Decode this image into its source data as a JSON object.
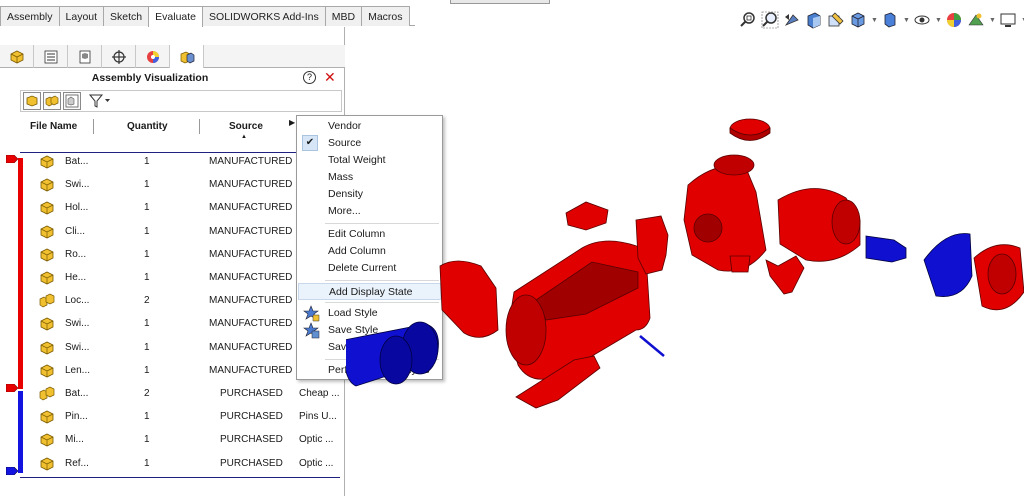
{
  "tabs": [
    {
      "label": "Assembly",
      "active": false
    },
    {
      "label": "Layout",
      "active": false
    },
    {
      "label": "Sketch",
      "active": false
    },
    {
      "label": "Evaluate",
      "active": true
    },
    {
      "label": "SOLIDWORKS Add-Ins",
      "active": false
    },
    {
      "label": "MBD",
      "active": false
    },
    {
      "label": "Macros",
      "active": false
    }
  ],
  "heads_up_toolbar": {
    "icons": [
      "zoom-to-fit-icon",
      "zoom-area-icon",
      "previous-view-icon",
      "section-view-icon",
      "dynamic-annotation-icon",
      "view-orientation-icon",
      "display-style-icon",
      "hide-show-icon",
      "edit-appearance-icon",
      "apply-scene-icon",
      "view-settings-icon"
    ]
  },
  "panel": {
    "title": "Assembly Visualization",
    "help_label": "?",
    "close_label": "✕",
    "tabs": [
      "feature-manager-icon",
      "property-manager-icon",
      "configuration-manager-icon",
      "dimxpert-manager-icon",
      "display-manager-icon",
      "assembly-visualization-icon"
    ],
    "columns": {
      "file_name": "File Name",
      "quantity": "Quantity",
      "source": "Source"
    },
    "colors": {
      "manufactured": "#e80000",
      "purchased": "#1414e0"
    }
  },
  "rows": [
    {
      "name": "Bat...",
      "qty": "1",
      "source": "MANUFACTURED",
      "vendor": "",
      "icon": "part"
    },
    {
      "name": "Swi...",
      "qty": "1",
      "source": "MANUFACTURED",
      "vendor": "",
      "icon": "part"
    },
    {
      "name": "Hol...",
      "qty": "1",
      "source": "MANUFACTURED",
      "vendor": "",
      "icon": "part"
    },
    {
      "name": "Cli...",
      "qty": "1",
      "source": "MANUFACTURED",
      "vendor": "",
      "icon": "part"
    },
    {
      "name": "Ro...",
      "qty": "1",
      "source": "MANUFACTURED",
      "vendor": "",
      "icon": "part"
    },
    {
      "name": "He...",
      "qty": "1",
      "source": "MANUFACTURED",
      "vendor": "",
      "icon": "part"
    },
    {
      "name": "Loc...",
      "qty": "2",
      "source": "MANUFACTURED",
      "vendor": "",
      "icon": "multi"
    },
    {
      "name": "Swi...",
      "qty": "1",
      "source": "MANUFACTURED",
      "vendor": "",
      "icon": "part"
    },
    {
      "name": "Swi...",
      "qty": "1",
      "source": "MANUFACTURED",
      "vendor": "",
      "icon": "part"
    },
    {
      "name": "Len...",
      "qty": "1",
      "source": "MANUFACTURED",
      "vendor": "",
      "icon": "part"
    },
    {
      "name": "Bat...",
      "qty": "2",
      "source": "PURCHASED",
      "vendor": "Cheap ...",
      "icon": "multi"
    },
    {
      "name": "Pin...",
      "qty": "1",
      "source": "PURCHASED",
      "vendor": "Pins U...",
      "icon": "part"
    },
    {
      "name": "Mi...",
      "qty": "1",
      "source": "PURCHASED",
      "vendor": "Optic ...",
      "icon": "part"
    },
    {
      "name": "Ref...",
      "qty": "1",
      "source": "PURCHASED",
      "vendor": "Optic ...",
      "icon": "part"
    }
  ],
  "context_menu": {
    "items": {
      "vendor": "Vendor",
      "source": "Source",
      "total_weight": "Total Weight",
      "mass": "Mass",
      "density": "Density",
      "more": "More...",
      "edit_column": "Edit Column",
      "add_column": "Add Column",
      "delete_current": "Delete Current",
      "add_display_state": "Add Display State",
      "load_style": "Load Style",
      "save_style": "Save Style",
      "save_as": "Save As ...",
      "performance_analysis": "Performance Analysis"
    },
    "checked_item": "Source",
    "hovered_item": "Add Display State"
  }
}
